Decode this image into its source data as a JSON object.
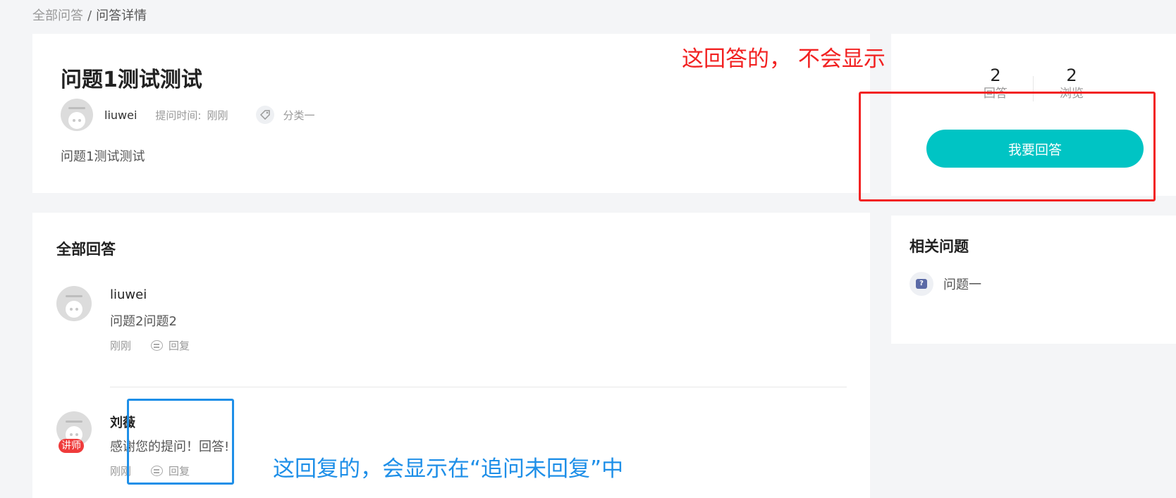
{
  "breadcrumb": {
    "root": "全部问答",
    "separator": "/",
    "current": "问答详情"
  },
  "question": {
    "title": "问题1测试测试",
    "author": "liuwei",
    "time_label": "提问时间:",
    "time": "刚刚",
    "category": "分类一",
    "body": "问题1测试测试",
    "tag_icon": "tag-icon"
  },
  "stats": {
    "answers_count": "2",
    "answers_label": "回答",
    "views_count": "2",
    "views_label": "浏览",
    "answer_button": "我要回答"
  },
  "answers_section": {
    "title": "全部回答",
    "items": [
      {
        "author": "liuwei",
        "text": "问题2问题2",
        "time": "刚刚",
        "reply_label": "回复",
        "badge": ""
      },
      {
        "author": "刘薇",
        "text": "感谢您的提问！回答!",
        "time": "刚刚",
        "reply_label": "回复",
        "badge": "讲师"
      }
    ]
  },
  "related": {
    "title": "相关问题",
    "items": [
      {
        "text": "问题一",
        "icon": "question-icon"
      }
    ]
  },
  "annotations": {
    "red_text": "这回答的，  不会显示",
    "blue_text": "这回复的，会显示在“追问未回复”中",
    "red_color": "#f22222",
    "blue_color": "#1e8fe8"
  },
  "colors": {
    "accent": "#00c4c4",
    "badge": "#ef3b3b",
    "background": "#f4f5f7"
  }
}
